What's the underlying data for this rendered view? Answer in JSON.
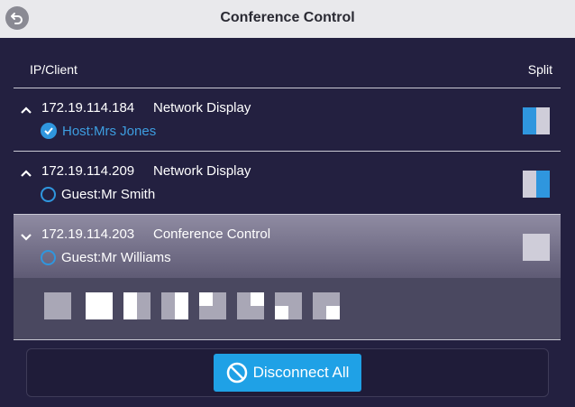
{
  "header": {
    "title": "Conference Control",
    "back_icon": "back-arrow-icon"
  },
  "table": {
    "col_client": "IP/Client",
    "col_split": "Split"
  },
  "clients": [
    {
      "ip": "172.19.114.184",
      "type": "Network Display",
      "user": "Host:Mrs Jones",
      "role": "host",
      "expanded": false,
      "split": "left-blue"
    },
    {
      "ip": "172.19.114.209",
      "type": "Network Display",
      "user": "Guest:Mr Smith",
      "role": "guest",
      "expanded": false,
      "split": "right-blue"
    },
    {
      "ip": "172.19.114.203",
      "type": "Conference Control",
      "user": "Guest:Mr Williams",
      "role": "guest",
      "expanded": true,
      "split": "full-grey"
    }
  ],
  "layout_options": [
    "full-grey",
    "full-white",
    "left-white",
    "right-white",
    "top-left-white",
    "top-right-white",
    "bottom-left-white",
    "bottom-right-white"
  ],
  "footer": {
    "disconnect_label": "Disconnect All",
    "disconnect_icon": "block-icon"
  },
  "colors": {
    "accent": "#1fa1e6",
    "background": "#232040",
    "host_text": "#3d9de0"
  }
}
